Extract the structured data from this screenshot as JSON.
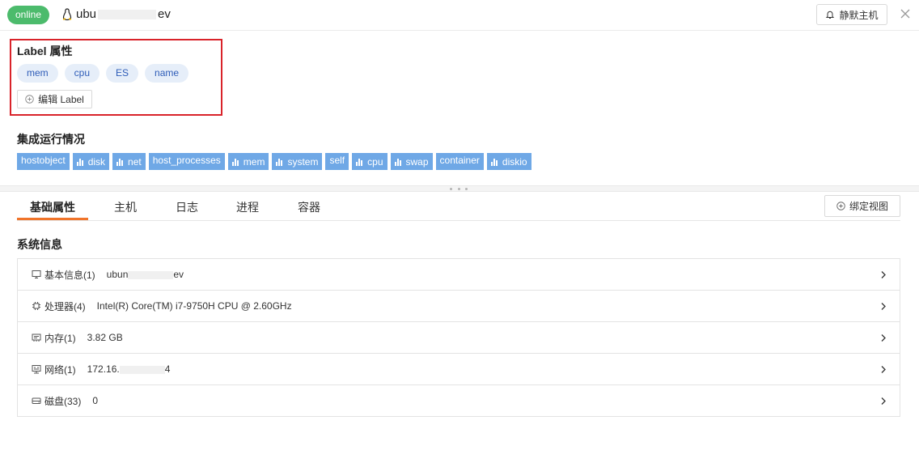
{
  "header": {
    "status": "online",
    "hostname_prefix": "ubu",
    "hostname_suffix": "ev",
    "mute_button": "静默主机"
  },
  "labels": {
    "title": "Label 属性",
    "tags": [
      "mem",
      "cpu",
      "ES",
      "name"
    ],
    "edit_button": "编辑 Label"
  },
  "integration": {
    "title": "集成运行情况",
    "items": [
      {
        "label": "hostobject",
        "chart_icon": false
      },
      {
        "label": "disk",
        "chart_icon": true
      },
      {
        "label": "net",
        "chart_icon": true
      },
      {
        "label": "host_processes",
        "chart_icon": false
      },
      {
        "label": "mem",
        "chart_icon": true
      },
      {
        "label": "system",
        "chart_icon": true
      },
      {
        "label": "self",
        "chart_icon": false
      },
      {
        "label": "cpu",
        "chart_icon": true
      },
      {
        "label": "swap",
        "chart_icon": true
      },
      {
        "label": "container",
        "chart_icon": false
      },
      {
        "label": "diskio",
        "chart_icon": true
      }
    ],
    "colors": {
      "tag_bg": "#6fa8e6",
      "tag_text": "#ffffff"
    }
  },
  "tabs": {
    "items": [
      "基础属性",
      "主机",
      "日志",
      "进程",
      "容器"
    ],
    "active": "基础属性",
    "bind_view_button": "绑定视图"
  },
  "system_info": {
    "title": "系统信息",
    "rows": [
      {
        "icon": "monitor-icon",
        "label": "基本信息(1)",
        "value_prefix": "ubun",
        "value_suffix": "ev"
      },
      {
        "icon": "cpu-icon",
        "label": "处理器(4)",
        "value_prefix": "Intel(R) Core(TM) i7-9750H CPU @ 2.60GHz",
        "value_suffix": ""
      },
      {
        "icon": "memory-icon",
        "label": "内存(1)",
        "value_prefix": "3.82 GB",
        "value_suffix": ""
      },
      {
        "icon": "network-icon",
        "label": "网络(1)",
        "value_prefix": "172.16.",
        "value_suffix": "4"
      },
      {
        "icon": "disk-icon",
        "label": "磁盘(33)",
        "value_prefix": "0",
        "value_suffix": ""
      }
    ]
  },
  "colors": {
    "online": "#4cbb6c",
    "accent": "#f0742a",
    "highlight_border": "#d9232a",
    "label_tag_bg": "#e6eef9",
    "label_tag_text": "#2f5db8"
  }
}
